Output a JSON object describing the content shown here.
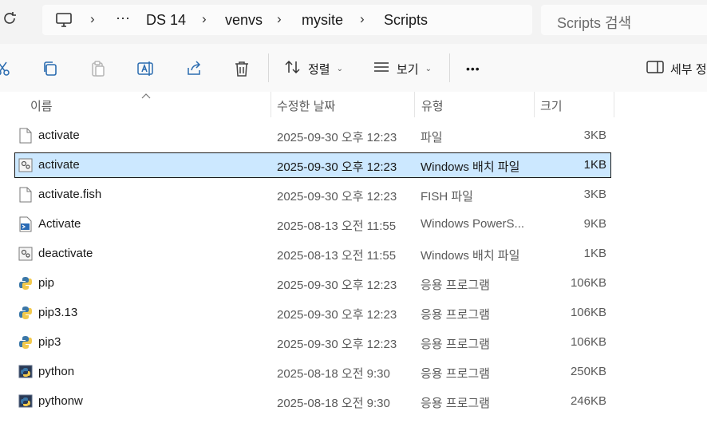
{
  "breadcrumb": {
    "items": [
      "DS 14",
      "venvs",
      "mysite",
      "Scripts"
    ],
    "more": "···"
  },
  "search": {
    "placeholder": "Scripts 검색"
  },
  "toolbar": {
    "sort_label": "정렬",
    "view_label": "보기",
    "more_label": "•••",
    "details_label": "세부 정"
  },
  "columns": {
    "name": "이름",
    "date": "수정한 날짜",
    "type": "유형",
    "size": "크기"
  },
  "files": [
    {
      "name": "activate",
      "date": "2025-09-30 오후 12:23",
      "type": "파일",
      "size": "3KB",
      "icon": "blank-file-icon",
      "selected": false
    },
    {
      "name": "activate",
      "date": "2025-09-30 오후 12:23",
      "type": "Windows 배치 파일",
      "size": "1KB",
      "icon": "batch-file-icon",
      "selected": true
    },
    {
      "name": "activate.fish",
      "date": "2025-09-30 오후 12:23",
      "type": "FISH 파일",
      "size": "3KB",
      "icon": "blank-file-icon",
      "selected": false
    },
    {
      "name": "Activate",
      "date": "2025-08-13 오전 11:55",
      "type": "Windows PowerS...",
      "size": "9KB",
      "icon": "powershell-script-icon",
      "selected": false
    },
    {
      "name": "deactivate",
      "date": "2025-08-13 오전 11:55",
      "type": "Windows 배치 파일",
      "size": "1KB",
      "icon": "batch-file-icon",
      "selected": false
    },
    {
      "name": "pip",
      "date": "2025-09-30 오후 12:23",
      "type": "응용 프로그램",
      "size": "106KB",
      "icon": "python-exe-icon",
      "selected": false
    },
    {
      "name": "pip3.13",
      "date": "2025-09-30 오후 12:23",
      "type": "응용 프로그램",
      "size": "106KB",
      "icon": "python-exe-icon",
      "selected": false
    },
    {
      "name": "pip3",
      "date": "2025-09-30 오후 12:23",
      "type": "응용 프로그램",
      "size": "106KB",
      "icon": "python-exe-icon",
      "selected": false
    },
    {
      "name": "python",
      "date": "2025-08-18 오전 9:30",
      "type": "응용 프로그램",
      "size": "250KB",
      "icon": "python-window-icon",
      "selected": false
    },
    {
      "name": "pythonw",
      "date": "2025-08-18 오전 9:30",
      "type": "응용 프로그램",
      "size": "246KB",
      "icon": "python-window-icon",
      "selected": false
    }
  ],
  "colors": {
    "selection": "#cce8ff",
    "topbar": "#f3f3f3",
    "toolbar": "#f9f9f9"
  }
}
